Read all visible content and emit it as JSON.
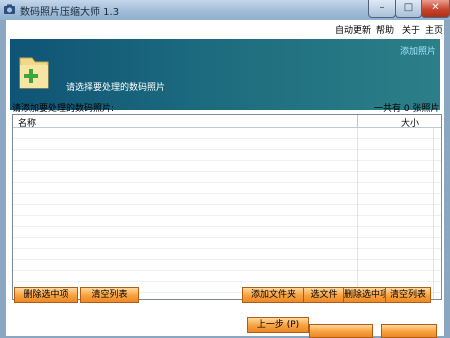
{
  "window": {
    "title": "数码照片压缩大师 1.3",
    "minimize_glyph": "–",
    "maximize_glyph": "□",
    "close_glyph": "✕"
  },
  "menu": {
    "items": [
      "自动更新",
      "帮助",
      "关于",
      "主页"
    ]
  },
  "header": {
    "prompt": "请选择要处理的数码照片",
    "link": "添加照片"
  },
  "list": {
    "caption": "请添加要处理的数码照片:",
    "count_text": "一共有 0 张照片",
    "columns": [
      "名称",
      "大小"
    ],
    "rows": []
  },
  "buttons": {
    "delete_selected": "删除选中项",
    "clear_list": "清空列表",
    "add_folder": "添加文件夹",
    "select_file": "选文件",
    "delete_selected_2": "删除选中项",
    "clear_list_2": "清空列表",
    "prev_step": "上一步 (P)"
  },
  "icons": {
    "app": "app-icon",
    "folder": "folder-add-icon"
  },
  "colors": {
    "header_start": "#0f5476",
    "header_end": "#2c7f88",
    "button": "#f9a03a",
    "link": "#9fe4ff"
  }
}
